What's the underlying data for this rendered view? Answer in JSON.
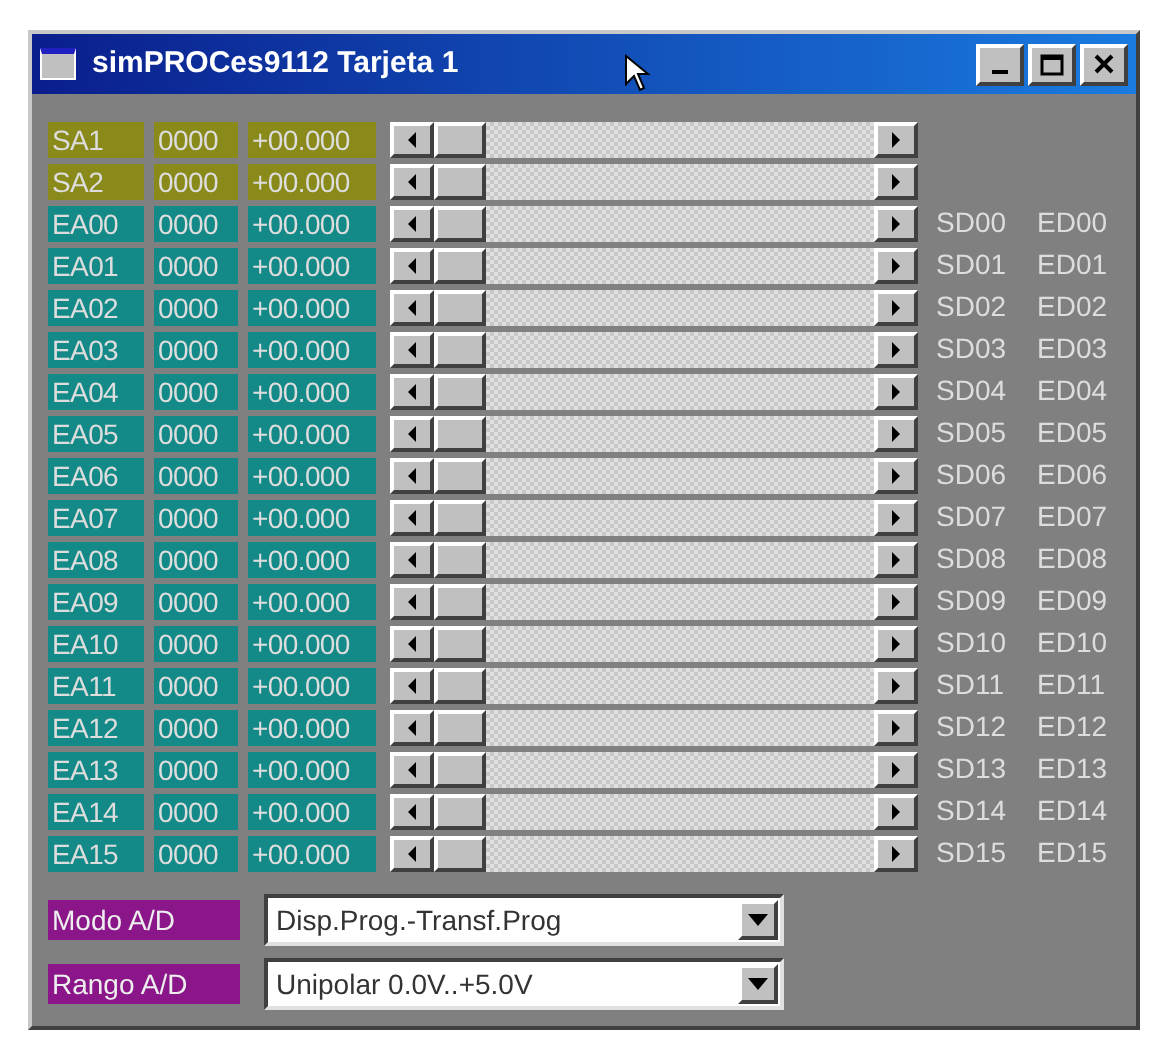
{
  "window": {
    "title": "simPROCes9112 Tarjeta 1"
  },
  "channels": [
    {
      "kind": "output",
      "name": "SA1",
      "code": "0000",
      "value": "+00.000",
      "level": 0
    },
    {
      "kind": "output",
      "name": "SA2",
      "code": "0000",
      "value": "+00.000",
      "level": 0
    },
    {
      "kind": "input",
      "name": "EA00",
      "code": "0000",
      "value": "+00.000",
      "level": 0,
      "sd": "SD00",
      "ed": "ED00"
    },
    {
      "kind": "input",
      "name": "EA01",
      "code": "0000",
      "value": "+00.000",
      "level": 0,
      "sd": "SD01",
      "ed": "ED01"
    },
    {
      "kind": "input",
      "name": "EA02",
      "code": "0000",
      "value": "+00.000",
      "level": 0,
      "sd": "SD02",
      "ed": "ED02"
    },
    {
      "kind": "input",
      "name": "EA03",
      "code": "0000",
      "value": "+00.000",
      "level": 0,
      "sd": "SD03",
      "ed": "ED03"
    },
    {
      "kind": "input",
      "name": "EA04",
      "code": "0000",
      "value": "+00.000",
      "level": 0,
      "sd": "SD04",
      "ed": "ED04"
    },
    {
      "kind": "input",
      "name": "EA05",
      "code": "0000",
      "value": "+00.000",
      "level": 0,
      "sd": "SD05",
      "ed": "ED05"
    },
    {
      "kind": "input",
      "name": "EA06",
      "code": "0000",
      "value": "+00.000",
      "level": 0,
      "sd": "SD06",
      "ed": "ED06"
    },
    {
      "kind": "input",
      "name": "EA07",
      "code": "0000",
      "value": "+00.000",
      "level": 0,
      "sd": "SD07",
      "ed": "ED07"
    },
    {
      "kind": "input",
      "name": "EA08",
      "code": "0000",
      "value": "+00.000",
      "level": 0,
      "sd": "SD08",
      "ed": "ED08"
    },
    {
      "kind": "input",
      "name": "EA09",
      "code": "0000",
      "value": "+00.000",
      "level": 0,
      "sd": "SD09",
      "ed": "ED09"
    },
    {
      "kind": "input",
      "name": "EA10",
      "code": "0000",
      "value": "+00.000",
      "level": 0,
      "sd": "SD10",
      "ed": "ED10"
    },
    {
      "kind": "input",
      "name": "EA11",
      "code": "0000",
      "value": "+00.000",
      "level": 0,
      "sd": "SD11",
      "ed": "ED11"
    },
    {
      "kind": "input",
      "name": "EA12",
      "code": "0000",
      "value": "+00.000",
      "level": 0,
      "sd": "SD12",
      "ed": "ED12"
    },
    {
      "kind": "input",
      "name": "EA13",
      "code": "0000",
      "value": "+00.000",
      "level": 0,
      "sd": "SD13",
      "ed": "ED13"
    },
    {
      "kind": "input",
      "name": "EA14",
      "code": "0000",
      "value": "+00.000",
      "level": 0,
      "sd": "SD14",
      "ed": "ED14"
    },
    {
      "kind": "input",
      "name": "EA15",
      "code": "0000",
      "value": "+00.000",
      "level": 0,
      "sd": "SD15",
      "ed": "ED15"
    }
  ],
  "settings": [
    {
      "label": "Modo A/D",
      "value": "Disp.Prog.-Transf.Prog"
    },
    {
      "label": "Rango A/D",
      "value": "Unipolar 0.0V..+5.0V"
    }
  ]
}
